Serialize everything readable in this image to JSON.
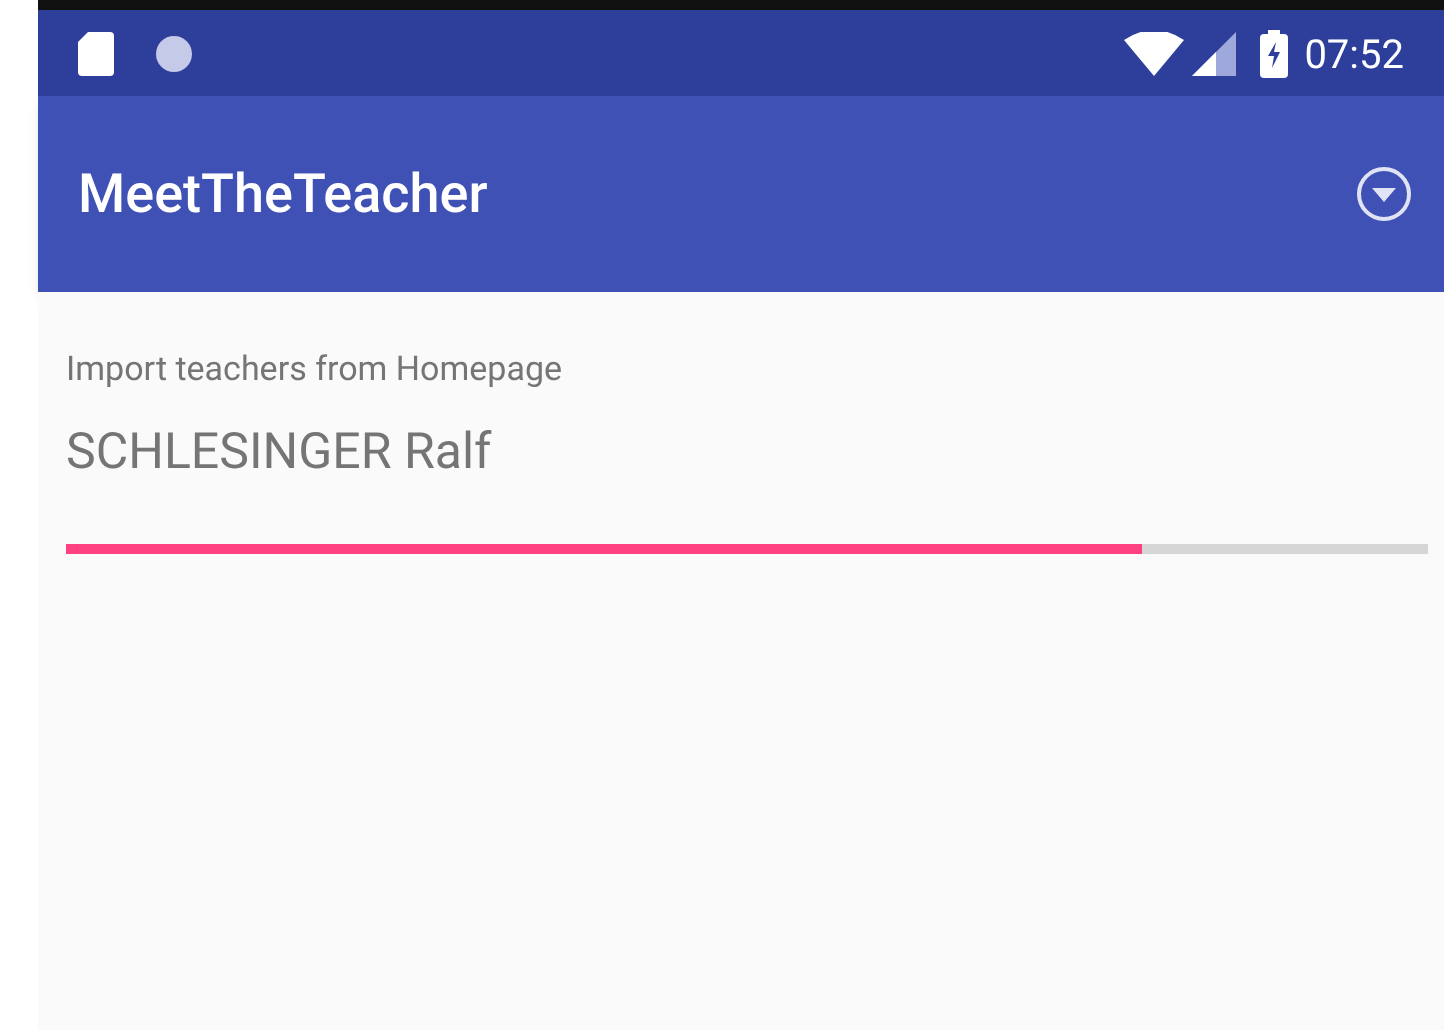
{
  "status_bar": {
    "time": "07:52"
  },
  "app_bar": {
    "title": "MeetTheTeacher"
  },
  "import": {
    "label": "Import teachers from Homepage",
    "current": "SCHLESINGER Ralf",
    "level": 0.79
  }
}
